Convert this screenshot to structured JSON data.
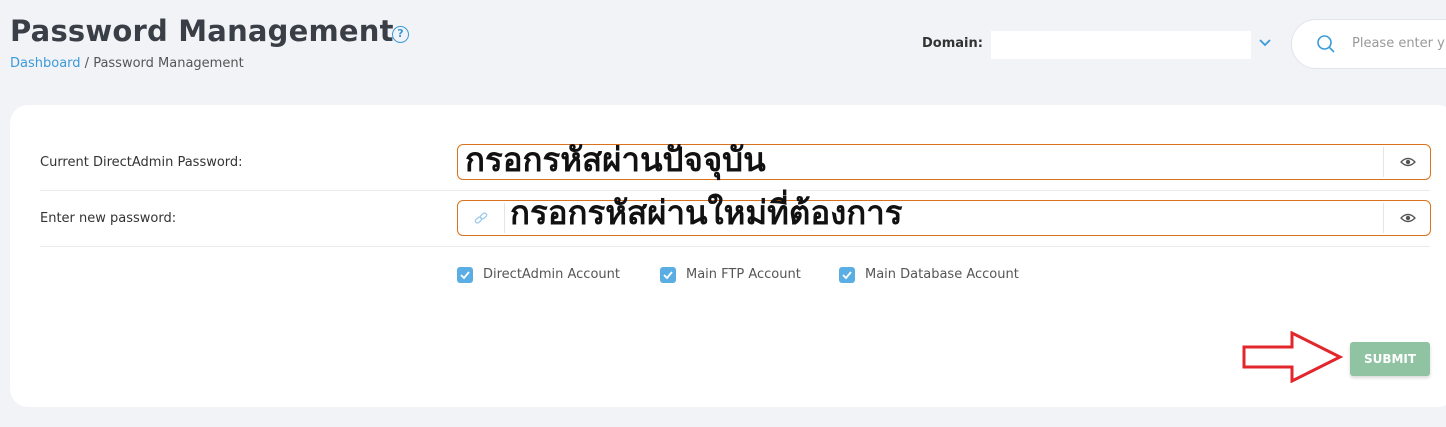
{
  "header": {
    "title": "Password Management",
    "help_glyph": "?",
    "breadcrumb": {
      "link": "Dashboard",
      "separator": " / ",
      "current": "Password Management"
    }
  },
  "domain": {
    "label": "Domain:",
    "value": ""
  },
  "search": {
    "placeholder": "Please enter y"
  },
  "form": {
    "current_password_label": "Current DirectAdmin Password:",
    "new_password_label": "Enter new password:",
    "annotation_current": "กรอกรหัสผ่านปัจจุบัน",
    "annotation_new": "กรอกรหัสผ่านใหม่ที่ต้องการ",
    "checkboxes": [
      {
        "label": "DirectAdmin Account",
        "checked": true
      },
      {
        "label": "Main FTP Account",
        "checked": true
      },
      {
        "label": "Main Database Account",
        "checked": true
      }
    ],
    "submit_label": "SUBMIT"
  },
  "colors": {
    "accent": "#3a9bd9",
    "field_border": "#d9711d",
    "submit_bg": "#8fc3a2",
    "arrow": "#e3262b"
  },
  "icons": [
    "help-icon",
    "chevron-down-icon",
    "search-icon",
    "eye-icon",
    "generate-password-icon",
    "check-icon",
    "red-arrow-annotation"
  ]
}
